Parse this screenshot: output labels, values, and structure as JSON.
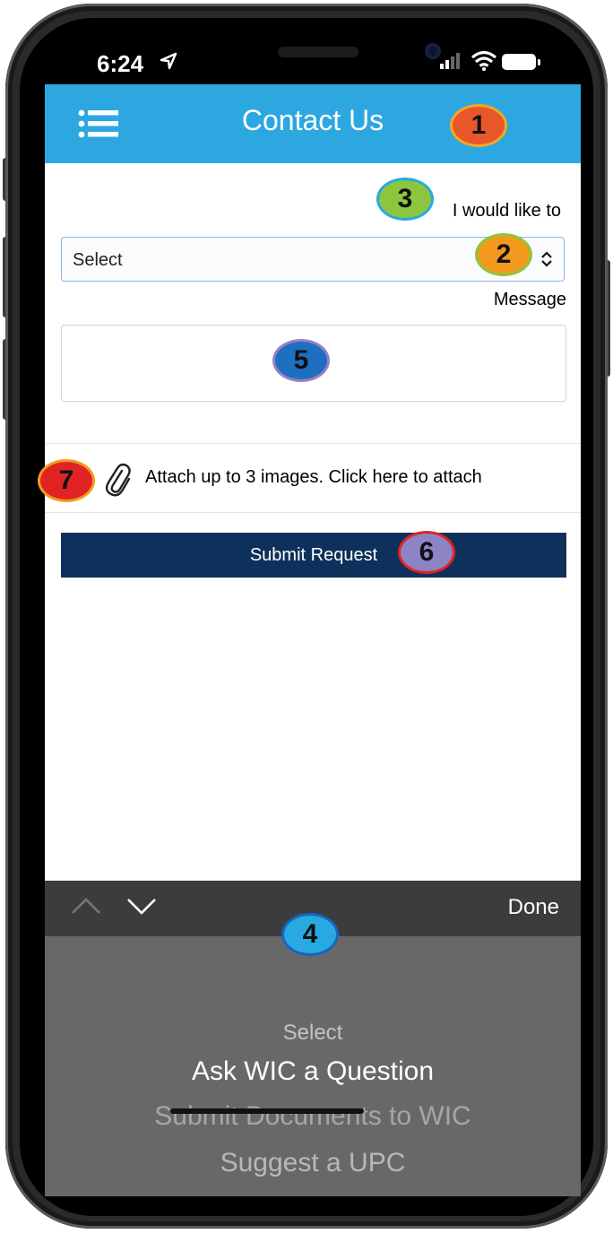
{
  "status_bar": {
    "time": "6:24"
  },
  "header": {
    "title": "Contact Us"
  },
  "form": {
    "request_label": "I would like to",
    "select_value": "Select",
    "message_label": "Message",
    "message_value": "",
    "attach_text": "Attach up to 3 images. Click here to attach",
    "submit_label": "Submit Request"
  },
  "keyboard_toolbar": {
    "done_label": "Done"
  },
  "picker": {
    "options": [
      "Select",
      "Ask WIC a Question",
      "Submit Documents to WIC",
      "Suggest a UPC"
    ],
    "selected": "Ask WIC a Question"
  },
  "annotations": {
    "badges": [
      {
        "label": "1",
        "color": "#e8572a",
        "ring": "#f5a623"
      },
      {
        "label": "2",
        "color": "#f39a1e",
        "ring": "#8cc63f"
      },
      {
        "label": "3",
        "color": "#8cc63f",
        "ring": "#29a9e1"
      },
      {
        "label": "4",
        "color": "#29a9e1",
        "ring": "#1565c0"
      },
      {
        "label": "5",
        "color": "#1e6fbf",
        "ring": "#9b7fc4"
      },
      {
        "label": "6",
        "color": "#8d84c6",
        "ring": "#e02424"
      },
      {
        "label": "7",
        "color": "#e02424",
        "ring": "#f39a1e"
      }
    ]
  },
  "colors": {
    "header_bg": "#2da7e0",
    "submit_bg": "#0e315c",
    "toolbar_bg": "#3c3c3c",
    "picker_bg": "#686868"
  }
}
